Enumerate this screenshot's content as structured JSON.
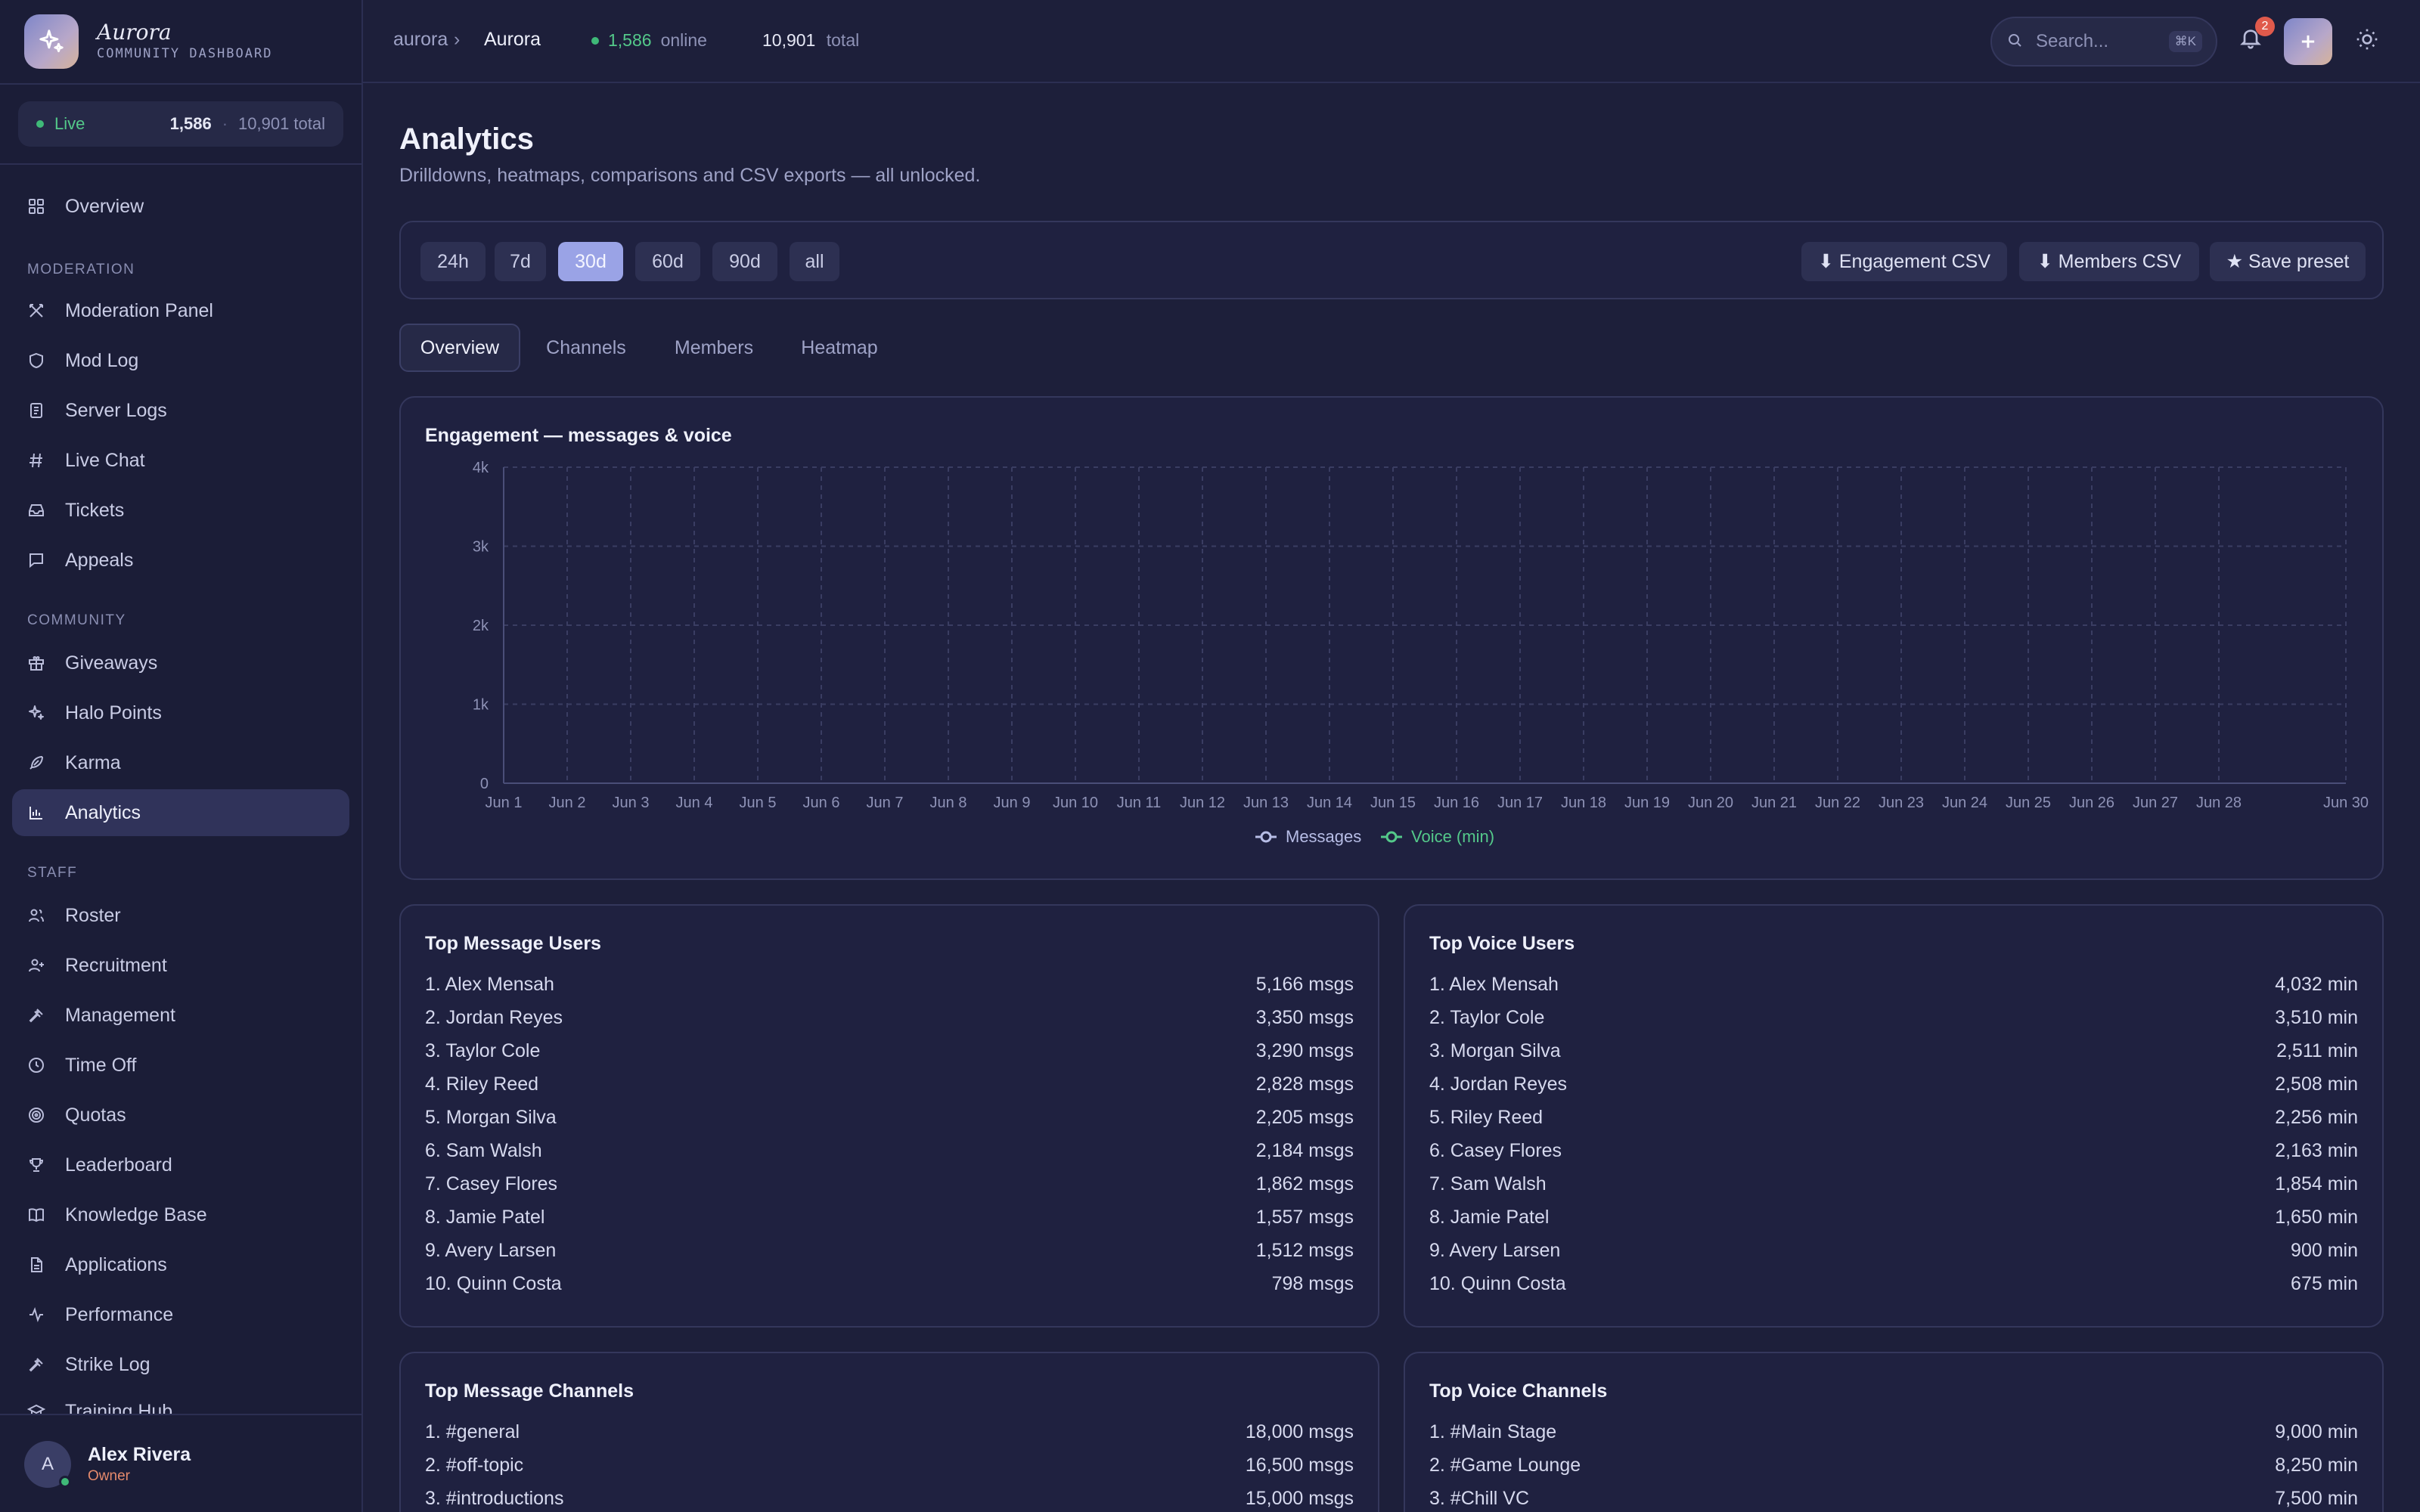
{
  "brand": {
    "name": "Aurora",
    "subtitle": "COMMUNITY DASHBOARD"
  },
  "sidebar": {
    "live": {
      "label": "Live",
      "count": "1,586",
      "total": "10,901 total"
    },
    "overview": "Overview",
    "sections": {
      "moderation": "MODERATION",
      "community": "COMMUNITY",
      "staff": "STAFF"
    },
    "moderation_items": [
      "Moderation Panel",
      "Mod Log",
      "Server Logs",
      "Live Chat",
      "Tickets",
      "Appeals"
    ],
    "community_items": [
      "Giveaways",
      "Halo Points",
      "Karma",
      "Analytics"
    ],
    "staff_items": [
      "Roster",
      "Recruitment",
      "Management",
      "Time Off",
      "Quotas",
      "Leaderboard",
      "Knowledge Base",
      "Applications",
      "Performance",
      "Strike Log",
      "Training Hub"
    ],
    "active_item": "Analytics",
    "user": {
      "initial": "A",
      "name": "Alex Rivera",
      "role": "Owner"
    }
  },
  "topbar": {
    "breadcrumb_root": "aurora",
    "breadcrumb_sep": "›",
    "breadcrumb_current": "Aurora",
    "online_count": "1,586",
    "online_label": "online",
    "total_count": "10,901",
    "total_label": "total",
    "search_placeholder": "Search...",
    "search_shortcut": "⌘K",
    "notifications": "2"
  },
  "page": {
    "title": "Analytics",
    "subtitle": "Drilldowns, heatmaps, comparisons and CSV exports — all unlocked."
  },
  "toolbar": {
    "ranges": [
      "24h",
      "7d",
      "30d",
      "60d",
      "90d",
      "all"
    ],
    "active_range": "30d",
    "actions": [
      "⬇ Engagement CSV",
      "⬇ Members CSV",
      "★ Save preset"
    ]
  },
  "tabs": [
    "Overview",
    "Channels",
    "Members",
    "Heatmap"
  ],
  "active_tab": "Overview",
  "colors": {
    "accent": "#9aa3e6",
    "online": "#3fb978",
    "messages": "#b7bde6",
    "voice": "#54c98a",
    "role": "#e58a6c"
  },
  "chart_data": {
    "type": "line",
    "title": "Engagement — messages & voice",
    "x": [
      "Jun 1",
      "Jun 2",
      "Jun 3",
      "Jun 4",
      "Jun 5",
      "Jun 6",
      "Jun 7",
      "Jun 8",
      "Jun 9",
      "Jun 10",
      "Jun 11",
      "Jun 12",
      "Jun 13",
      "Jun 14",
      "Jun 15",
      "Jun 16",
      "Jun 17",
      "Jun 18",
      "Jun 19",
      "Jun 20",
      "Jun 21",
      "Jun 22",
      "Jun 23",
      "Jun 24",
      "Jun 25",
      "Jun 26",
      "Jun 27",
      "Jun 28",
      "Jun 30"
    ],
    "yticks": [
      "0",
      "1k",
      "2k",
      "3k",
      "4k"
    ],
    "ylim": [
      0,
      4000
    ],
    "series": [
      {
        "name": "Messages",
        "values": []
      },
      {
        "name": "Voice (min)",
        "values": []
      }
    ],
    "grid": true,
    "legend": "bottom-center"
  },
  "top_message_users": {
    "title": "Top Message Users",
    "rows": [
      {
        "name": "1. Alex Mensah",
        "value": "5,166 msgs"
      },
      {
        "name": "2. Jordan Reyes",
        "value": "3,350 msgs"
      },
      {
        "name": "3. Taylor Cole",
        "value": "3,290 msgs"
      },
      {
        "name": "4. Riley Reed",
        "value": "2,828 msgs"
      },
      {
        "name": "5. Morgan Silva",
        "value": "2,205 msgs"
      },
      {
        "name": "6. Sam Walsh",
        "value": "2,184 msgs"
      },
      {
        "name": "7. Casey Flores",
        "value": "1,862 msgs"
      },
      {
        "name": "8. Jamie Patel",
        "value": "1,557 msgs"
      },
      {
        "name": "9. Avery Larsen",
        "value": "1,512 msgs"
      },
      {
        "name": "10. Quinn Costa",
        "value": "798 msgs"
      }
    ]
  },
  "top_voice_users": {
    "title": "Top Voice Users",
    "rows": [
      {
        "name": "1. Alex Mensah",
        "value": "4,032 min"
      },
      {
        "name": "2. Taylor Cole",
        "value": "3,510 min"
      },
      {
        "name": "3. Morgan Silva",
        "value": "2,511 min"
      },
      {
        "name": "4. Jordan Reyes",
        "value": "2,508 min"
      },
      {
        "name": "5. Riley Reed",
        "value": "2,256 min"
      },
      {
        "name": "6. Casey Flores",
        "value": "2,163 min"
      },
      {
        "name": "7. Sam Walsh",
        "value": "1,854 min"
      },
      {
        "name": "8. Jamie Patel",
        "value": "1,650 min"
      },
      {
        "name": "9. Avery Larsen",
        "value": "900 min"
      },
      {
        "name": "10. Quinn Costa",
        "value": "675 min"
      }
    ]
  },
  "top_message_channels": {
    "title": "Top Message Channels",
    "rows": [
      {
        "name": "1. #general",
        "value": "18,000 msgs"
      },
      {
        "name": "2. #off-topic",
        "value": "16,500 msgs"
      },
      {
        "name": "3. #introductions",
        "value": "15,000 msgs"
      }
    ]
  },
  "top_voice_channels": {
    "title": "Top Voice Channels",
    "rows": [
      {
        "name": "1. #Main Stage",
        "value": "9,000 min"
      },
      {
        "name": "2. #Game Lounge",
        "value": "8,250 min"
      },
      {
        "name": "3. #Chill VC",
        "value": "7,500 min"
      }
    ]
  }
}
